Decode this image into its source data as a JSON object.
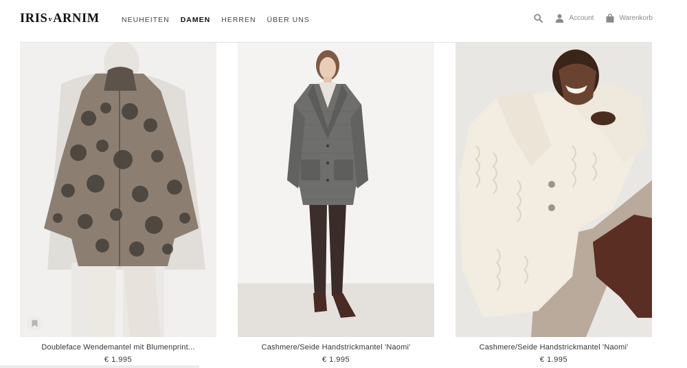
{
  "brand": {
    "left": "IRIS",
    "v": "v",
    "right": "ARNIM"
  },
  "nav": [
    {
      "label": "NEUHEITEN",
      "active": false
    },
    {
      "label": "DAMEN",
      "active": true
    },
    {
      "label": "HERREN",
      "active": false
    },
    {
      "label": "ÜBER UNS",
      "active": false
    }
  ],
  "tools": {
    "search_icon": "search-icon",
    "account_label": "Account",
    "cart_label": "Warenkorb"
  },
  "products": [
    {
      "title": "Doubleface Wendemantel mit Blumenprint...",
      "price": "€ 1.995",
      "image": "floral-coat-photo"
    },
    {
      "title": "Cashmere/Seide Handstrickmantel 'Naomi'",
      "price": "€ 1.995",
      "image": "grey-knit-coat-photo"
    },
    {
      "title": "Cashmere/Seide Handstrickmantel 'Naomi'",
      "price": "€ 1.995",
      "image": "cream-knit-coat-photo"
    }
  ],
  "colors": {
    "accent": "#111111",
    "muted": "#8a8a8a",
    "background": "#ffffff"
  }
}
